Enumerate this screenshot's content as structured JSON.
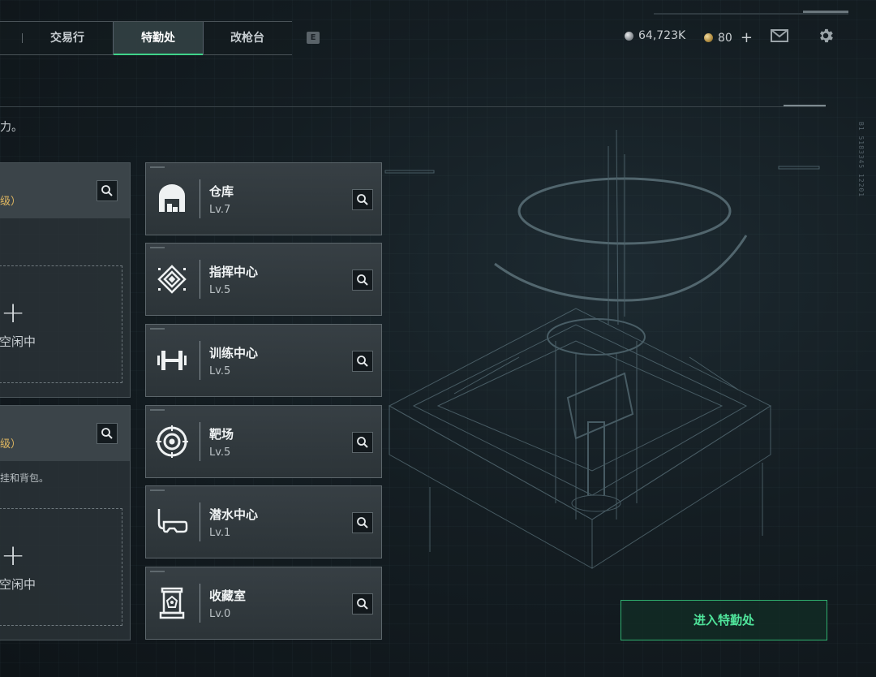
{
  "nav": {
    "tabs": [
      {
        "label": "交易行",
        "active": false
      },
      {
        "label": "特勤处",
        "active": true
      },
      {
        "label": "改枪台",
        "active": false
      }
    ],
    "key_hint": "E"
  },
  "currency": {
    "silver": "64,723K",
    "gold": "80"
  },
  "description_fragment": "力。",
  "left_panels": [
    {
      "level_fragment": "级）",
      "hint": "",
      "slot_status_fragment": "空闲中"
    },
    {
      "level_fragment": "级）",
      "hint": "挂和背包。",
      "slot_status_fragment": "空闲中"
    }
  ],
  "facilities": [
    {
      "name": "仓库",
      "level": "Lv.7",
      "icon": "warehouse-icon"
    },
    {
      "name": "指挥中心",
      "level": "Lv.5",
      "icon": "command-center-icon"
    },
    {
      "name": "训练中心",
      "level": "Lv.5",
      "icon": "dumbbell-icon"
    },
    {
      "name": "靶场",
      "level": "Lv.5",
      "icon": "target-icon"
    },
    {
      "name": "潜水中心",
      "level": "Lv.1",
      "icon": "diving-mask-icon"
    },
    {
      "name": "收藏室",
      "level": "Lv.0",
      "icon": "collection-case-icon"
    }
  ],
  "enter_button": "进入特勤处",
  "colors": {
    "accent_green": "#3fd38a",
    "level_gold": "#e0b760"
  },
  "side_code": "B1 5183345 12201"
}
